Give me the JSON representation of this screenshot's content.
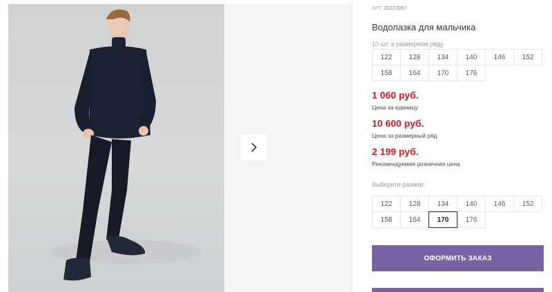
{
  "product": {
    "article_label": "АРТ.",
    "article_number": "22217097",
    "title": "Водолазка для мальчика",
    "pack_hint": "10 шт. в размерном ряду",
    "pack_sizes": [
      [
        "122",
        "128",
        "134",
        "140",
        "146",
        "152"
      ],
      [
        "158",
        "164",
        "170",
        "176"
      ]
    ],
    "prices": [
      {
        "value": "1 060 руб.",
        "label": "Цена за единицу"
      },
      {
        "value": "10 600 руб.",
        "label": "Цена за размерный ряд"
      },
      {
        "value": "2 199 руб.",
        "label": "Рекомендуемая розничная цена"
      }
    ],
    "select_hint": "Выберите размер:",
    "select_sizes": [
      [
        "122",
        "128",
        "134",
        "140",
        "146",
        "152"
      ],
      [
        "158",
        "164",
        "170",
        "176"
      ]
    ],
    "selected_size": "170",
    "order_button": "ОФОРМИТЬ ЗАКАЗ"
  },
  "gallery": {
    "next_icon": "chevron-right-icon"
  },
  "colors": {
    "price": "#d21a25",
    "button": "#7b62a2"
  }
}
